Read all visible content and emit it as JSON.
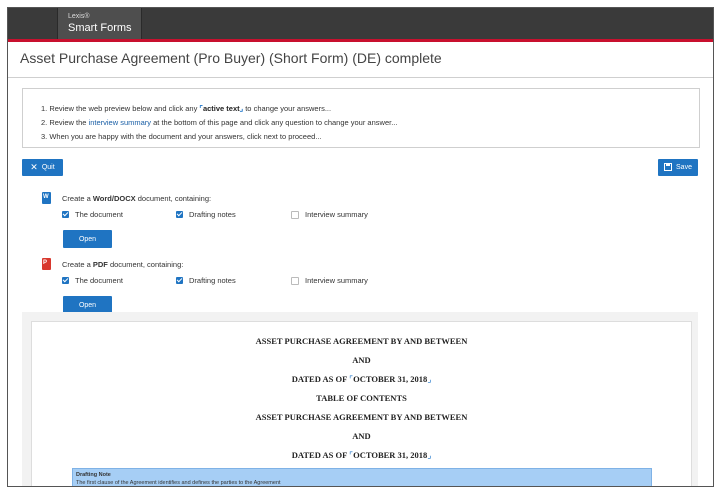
{
  "header": {
    "brand_small": "Lexis®",
    "brand_name": "Smart Forms"
  },
  "document_title": "Asset Purchase Agreement (Pro Buyer) (Short Form) (DE) complete",
  "instructions": {
    "line1_pre": "1. Review the web preview below and click any ",
    "line1_active": "active text",
    "line1_post": " to change your answers...",
    "line2_pre": "2. Review the ",
    "line2_link": "interview summary",
    "line2_post": " at the bottom of this page and click any question to change your answer...",
    "line3": "3. When you are happy with the document and your answers, click next to proceed..."
  },
  "toolbar": {
    "quit_label": "Quit",
    "save_label": "Save"
  },
  "word_section": {
    "text_pre": "Create a ",
    "format": "Word/DOCX",
    "text_post": " document, containing:",
    "options": [
      {
        "label": "The document",
        "checked": true
      },
      {
        "label": "Drafting notes",
        "checked": true
      },
      {
        "label": "Interview summary",
        "checked": false
      }
    ],
    "open_label": "Open"
  },
  "pdf_section": {
    "text_pre": "Create a ",
    "format": "PDF",
    "text_post": " document, containing:",
    "options": [
      {
        "label": "The document",
        "checked": true
      },
      {
        "label": "Drafting notes",
        "checked": true
      },
      {
        "label": "Interview summary",
        "checked": false
      }
    ],
    "open_label": "Open"
  },
  "preview": {
    "line1": "ASSET PURCHASE AGREEMENT BY AND BETWEEN",
    "line2": "AND",
    "line3_pre": "DATED AS OF ",
    "line3_date": "OCTOBER 31, 2018",
    "line4": "TABLE OF CONTENTS",
    "line5": "ASSET PURCHASE AGREEMENT BY AND BETWEEN",
    "line6": "AND",
    "line7_pre": "DATED AS OF ",
    "line7_date": "OCTOBER 31, 2018",
    "note_heading": "Drafting Note",
    "note_body": "The first clause of the Agreement identifies and defines the parties to the Agreement"
  },
  "colors": {
    "accent": "#1f74c2",
    "topbar": "#3a3a3a",
    "brand_red": "#c8102e",
    "note_bg": "#a6cef5"
  },
  "icons": {
    "quit": "close-icon",
    "save": "floppy-disk-icon",
    "word": "word-file-icon",
    "pdf": "pdf-file-icon"
  }
}
